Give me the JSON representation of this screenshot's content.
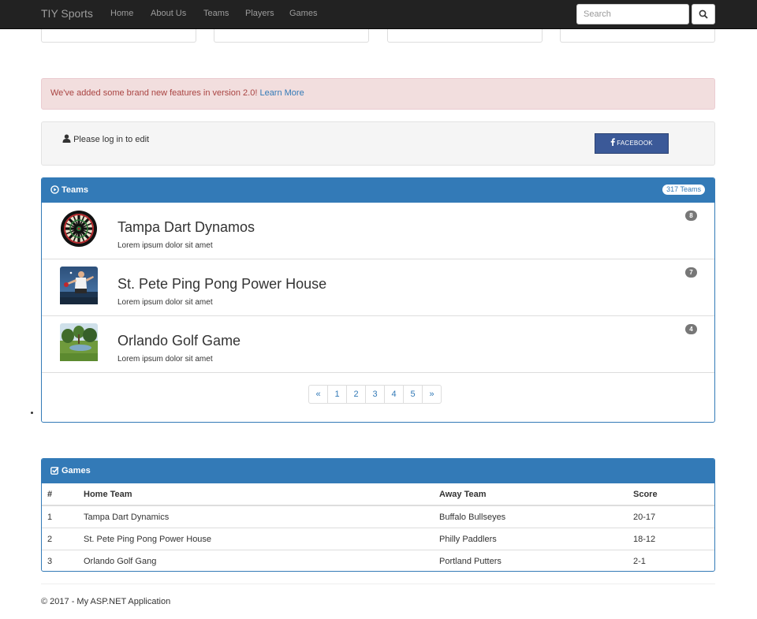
{
  "navbar": {
    "brand": "TIY Sports",
    "links": [
      "Home",
      "About Us",
      "Teams",
      "Players",
      "Games"
    ],
    "search_placeholder": "Search"
  },
  "alert": {
    "text": "We've added some brand new features in version 2.0! ",
    "link": "Learn More"
  },
  "login": {
    "note": "Please log in to edit",
    "facebook_label": "FACEBOOK"
  },
  "teams_panel": {
    "title": "Teams",
    "count_badge": "317 Teams",
    "items": [
      {
        "name": "Tampa Dart Dynamos",
        "desc": "Lorem ipsum dolor sit amet",
        "count": "8",
        "image": "dartboard"
      },
      {
        "name": "St. Pete Ping Pong Power House",
        "desc": "Lorem ipsum dolor sit amet",
        "count": "7",
        "image": "ping-pong-player"
      },
      {
        "name": "Orlando Golf Game",
        "desc": "Lorem ipsum dolor sit amet",
        "count": "4",
        "image": "golf-course"
      }
    ],
    "pagination": [
      "«",
      "1",
      "2",
      "3",
      "4",
      "5",
      "»"
    ]
  },
  "games_panel": {
    "title": "Games",
    "columns": [
      "#",
      "Home Team",
      "Away Team",
      "Score"
    ],
    "rows": [
      [
        "1",
        "Tampa Dart Dynamics",
        "Buffalo Bullseyes",
        "20-17"
      ],
      [
        "2",
        "St. Pete Ping Pong Power House",
        "Philly Paddlers",
        "18-12"
      ],
      [
        "3",
        "Orlando Golf Gang",
        "Portland Putters",
        "2-1"
      ]
    ]
  },
  "footer": {
    "text": "© 2017 - My ASP.NET Application"
  },
  "colors": {
    "primary": "#337ab7",
    "navbar": "#222222",
    "alert_bg": "#f2dede",
    "alert_text": "#a94442",
    "facebook": "#3b5998",
    "badge": "#777777"
  }
}
